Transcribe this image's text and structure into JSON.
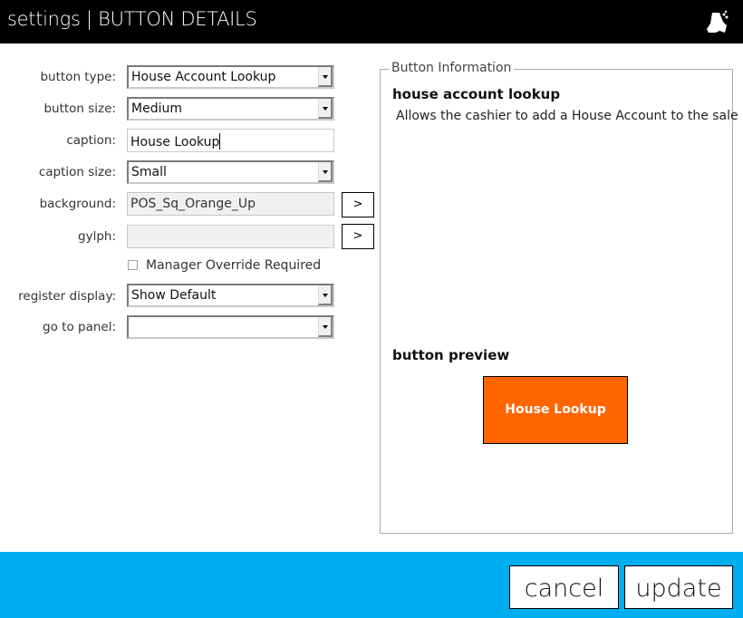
{
  "header": {
    "title": "settings | BUTTON DETAILS",
    "logo_icon": "app-logo-icon"
  },
  "form": {
    "button_type": {
      "label": "button type:",
      "value": "House Account Lookup"
    },
    "button_size": {
      "label": "button size:",
      "value": "Medium"
    },
    "caption": {
      "label": "caption:",
      "value": "House Lookup"
    },
    "caption_size": {
      "label": "caption size:",
      "value": "Small"
    },
    "background": {
      "label": "background:",
      "value": "POS_Sq_Orange_Up",
      "browse_label": ">"
    },
    "glyph": {
      "label": "gylph:",
      "value": "",
      "browse_label": ">"
    },
    "manager_override": {
      "label": "Manager Override Required",
      "checked": false
    },
    "register_display": {
      "label": "register display:",
      "value": "Show Default"
    },
    "go_to_panel": {
      "label": "go to panel:",
      "value": ""
    }
  },
  "info": {
    "group_title": "Button Information",
    "name": "house account lookup",
    "description": "Allows the cashier to add a House Account to the sale",
    "preview_label": "button preview",
    "preview_caption": "House Lookup",
    "preview_color": "#ff6600"
  },
  "footer": {
    "cancel_label": "cancel",
    "update_label": "update",
    "bar_color": "#00aeef"
  }
}
